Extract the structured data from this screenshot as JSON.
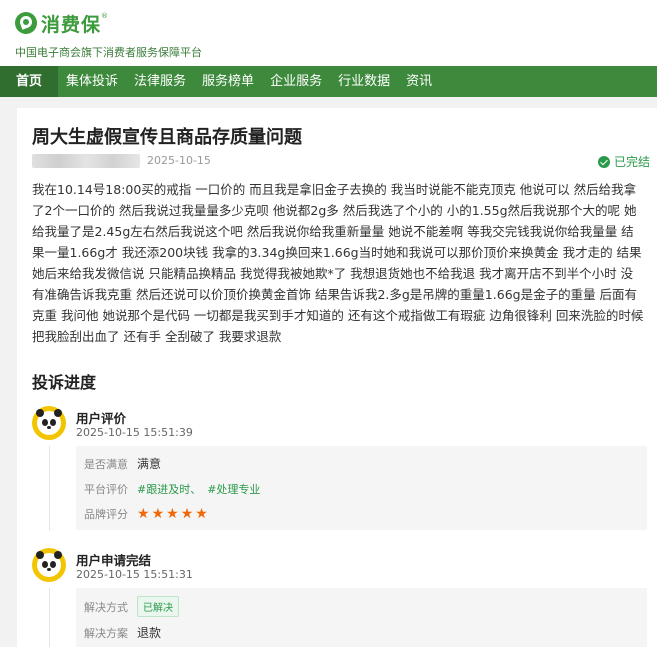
{
  "brand": {
    "name": "消费保",
    "registered": "®",
    "tagline": "中国电子商会旗下消费者服务保障平台"
  },
  "nav": {
    "items": [
      "首页",
      "集体投诉",
      "法律服务",
      "服务榜单",
      "企业服务",
      "行业数据",
      "资讯"
    ]
  },
  "complaint": {
    "title": "周大生虚假宣传且商品存质量问题",
    "date": "2025-10-15",
    "status": "已完结",
    "body": "我在10.14号18:00买的戒指 一口价的 而且我是拿旧金子去换的 我当时说能不能克顶克 他说可以 然后给我拿了2个一口价的 然后我说过我量量多少克呗 他说都2g多 然后我选了个小的 小的1.55g然后我说那个大的呢 她给我量了是2.45g左右然后我说这个吧 然后我说你给我重新量量 她说不能差啊 等我交完钱我说你给我量量 结果一量1.66g才 我还添200块钱 我拿的3.34g换回来1.66g当时她和我说可以那价顶价来换黄金 我才走的 结果她后来给我发微信说 只能精品换精品 我觉得我被她欺*了 我想退货她也不给我退 我才离开店不到半个小时 没有准确告诉我克重 然后还说可以价顶价换黄金首饰 结果告诉我2.多g是吊牌的重量1.66g是金子的重量 后面有克重 我问他 她说那个是代码 一切都是我买到手才知道的 还有这个戒指做工有瑕疵 边角很锋利 回来洗脸的时候把我脸刮出血了 还有手 全刮破了 我要求退款"
  },
  "progress": {
    "title": "投诉进度",
    "steps": [
      {
        "title": "用户评价",
        "time": "2025-10-15 15:51:39",
        "rows": [
          {
            "label": "是否满意",
            "value": "满意"
          },
          {
            "label": "平台评价",
            "tags": [
              "#跟进及时、",
              "#处理专业"
            ]
          },
          {
            "label": "品牌评分",
            "stars": 5
          }
        ]
      },
      {
        "title": "用户申请完结",
        "time": "2025-10-15 15:51:31",
        "rows": [
          {
            "label": "解决方式",
            "value": "已解决"
          },
          {
            "label": "解决方案",
            "value": "退款"
          }
        ]
      }
    ]
  },
  "colors": {
    "brand_green": "#3c9b3c",
    "nav_bg": "#3d8a3d",
    "nav_active": "#2f6e2f",
    "status_green": "#2a9a4a",
    "star_orange": "#f0680a"
  }
}
